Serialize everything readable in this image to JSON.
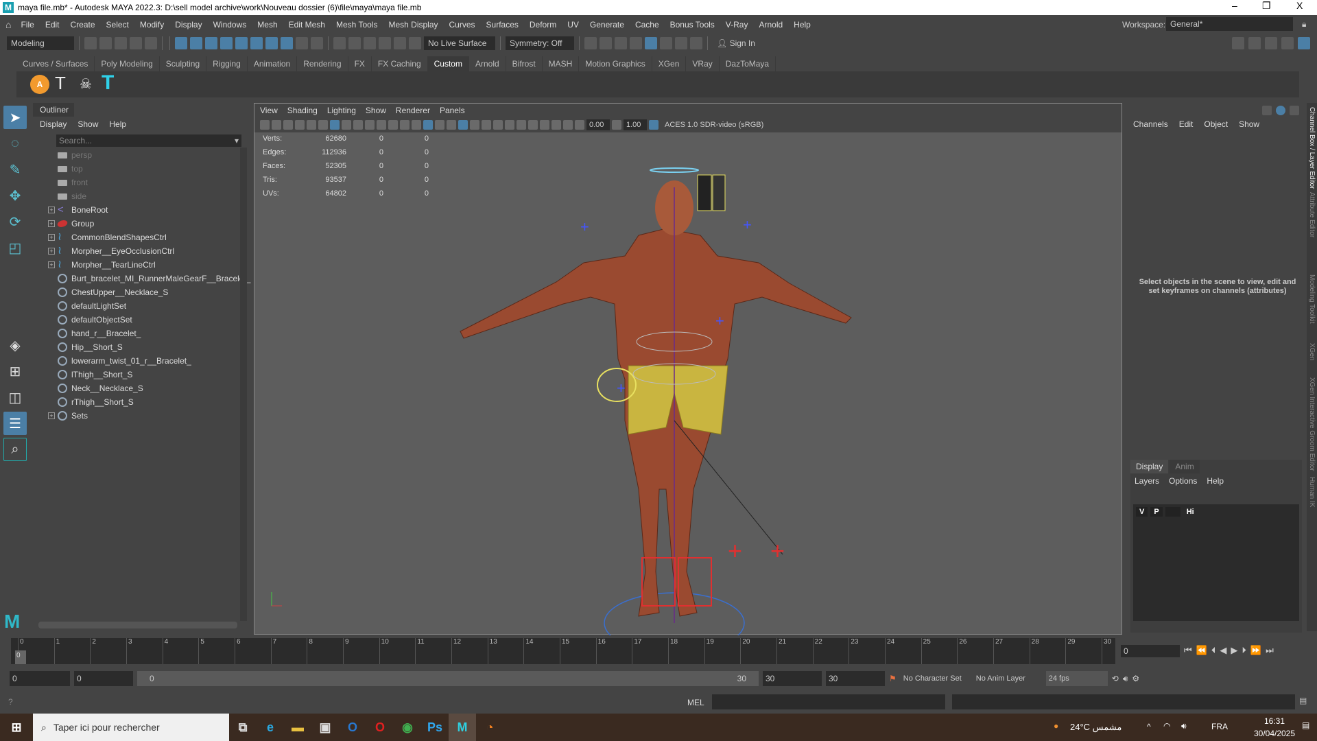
{
  "window": {
    "title": "maya file.mb* - Autodesk MAYA 2022.3: D:\\sell model archive\\work\\Nouveau dossier (6)\\file\\maya\\maya file.mb",
    "minimize": "–",
    "maximize": "❐",
    "close": "X"
  },
  "menu": [
    "File",
    "Edit",
    "Create",
    "Select",
    "Modify",
    "Display",
    "Windows",
    "Mesh",
    "Edit Mesh",
    "Mesh Tools",
    "Mesh Display",
    "Curves",
    "Surfaces",
    "Deform",
    "UV",
    "Generate",
    "Cache",
    "Bonus Tools",
    "V-Ray",
    "Arnold",
    "Help"
  ],
  "workspace": {
    "label": "Workspace:",
    "value": "General*"
  },
  "toolbar": {
    "mode": "Modeling",
    "live_surface": "No Live Surface",
    "symmetry": "Symmetry: Off",
    "sign_in": "Sign In"
  },
  "shelf_tabs": [
    "Curves / Surfaces",
    "Poly Modeling",
    "Sculpting",
    "Rigging",
    "Animation",
    "Rendering",
    "FX",
    "FX Caching",
    "Custom",
    "Arnold",
    "Bifrost",
    "MASH",
    "Motion Graphics",
    "XGen",
    "VRay",
    "DazToMaya"
  ],
  "shelf_active": "Custom",
  "outliner": {
    "title": "Outliner",
    "menu": [
      "Display",
      "Show",
      "Help"
    ],
    "search_placeholder": "Search...",
    "items": [
      {
        "label": "persp",
        "type": "camera",
        "expand": false
      },
      {
        "label": "top",
        "type": "camera",
        "expand": false
      },
      {
        "label": "front",
        "type": "camera",
        "expand": false
      },
      {
        "label": "side",
        "type": "camera",
        "expand": false
      },
      {
        "label": "BoneRoot",
        "type": "bone",
        "expand": true
      },
      {
        "label": "Group",
        "type": "group",
        "expand": true
      },
      {
        "label": "CommonBlendShapesCtrl",
        "type": "curve",
        "expand": true
      },
      {
        "label": "Morpher__EyeOcclusionCtrl",
        "type": "curve",
        "expand": true
      },
      {
        "label": "Morpher__TearLineCtrl",
        "type": "curve",
        "expand": true
      },
      {
        "label": "Burt_bracelet_MI_RunnerMaleGearF__Bracelet_",
        "type": "set",
        "expand": false
      },
      {
        "label": "ChestUpper__Necklace_S",
        "type": "set",
        "expand": false
      },
      {
        "label": "defaultLightSet",
        "type": "set",
        "expand": false
      },
      {
        "label": "defaultObjectSet",
        "type": "set",
        "expand": false
      },
      {
        "label": "hand_r__Bracelet_",
        "type": "set",
        "expand": false
      },
      {
        "label": "Hip__Short_S",
        "type": "set",
        "expand": false
      },
      {
        "label": "lowerarm_twist_01_r__Bracelet_",
        "type": "set",
        "expand": false
      },
      {
        "label": "lThigh__Short_S",
        "type": "set",
        "expand": false
      },
      {
        "label": "Neck__Necklace_S",
        "type": "set",
        "expand": false
      },
      {
        "label": "rThigh__Short_S",
        "type": "set",
        "expand": false
      },
      {
        "label": "Sets",
        "type": "set",
        "expand": true
      }
    ]
  },
  "viewport": {
    "menu": [
      "View",
      "Shading",
      "Lighting",
      "Show",
      "Renderer",
      "Panels"
    ],
    "exposure": "0.00",
    "gamma": "1.00",
    "color_space": "ACES 1.0 SDR-video (sRGB)",
    "hud": [
      [
        "Verts:",
        "62680",
        "0",
        "0"
      ],
      [
        "Edges:",
        "112936",
        "0",
        "0"
      ],
      [
        "Faces:",
        "52305",
        "0",
        "0"
      ],
      [
        "Tris:",
        "93537",
        "0",
        "0"
      ],
      [
        "UVs:",
        "64802",
        "0",
        "0"
      ]
    ]
  },
  "channel_box": {
    "menu": [
      "Channels",
      "Edit",
      "Object",
      "Show"
    ],
    "hint": "Select objects in the scene to view, edit and set keyframes on channels (attributes)"
  },
  "layer_editor": {
    "tabs": [
      "Display",
      "Anim"
    ],
    "menu": [
      "Layers",
      "Options",
      "Help"
    ],
    "row": {
      "v": "V",
      "p": "P",
      "name": "Hi"
    }
  },
  "side_tabs": [
    "Channel Box / Layer Editor",
    "Attribute Editor",
    "Modeling Toolkit",
    "XGen",
    "XGen Interactive Groom Editor",
    "Human IK"
  ],
  "timeline": {
    "ticks": [
      "0",
      "1",
      "2",
      "3",
      "4",
      "5",
      "6",
      "7",
      "8",
      "9",
      "10",
      "11",
      "12",
      "13",
      "14",
      "15",
      "16",
      "17",
      "18",
      "19",
      "20",
      "21",
      "22",
      "23",
      "24",
      "25",
      "26",
      "27",
      "28",
      "29",
      "30"
    ],
    "current": "0",
    "current_field": "0"
  },
  "range": {
    "start": "0",
    "playback_start": "0",
    "slider_start": "0",
    "slider_end": "30",
    "playback_end": "30",
    "end": "30",
    "character_set": "No Character Set",
    "anim_layer": "No Anim Layer",
    "fps": "24 fps"
  },
  "command": {
    "lang": "MEL"
  },
  "taskbar": {
    "search": "Taper ici pour rechercher",
    "weather": "24°C مشمس",
    "lang": "FRA",
    "time": "16:31",
    "date": "30/04/2025"
  }
}
